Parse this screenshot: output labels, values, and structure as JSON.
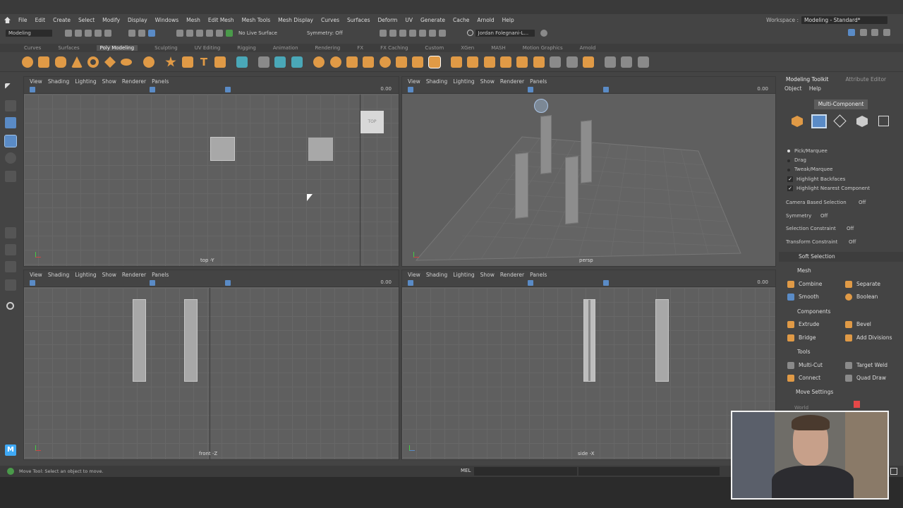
{
  "menubar": [
    "File",
    "Edit",
    "Create",
    "Select",
    "Modify",
    "Display",
    "Windows",
    "Mesh",
    "Edit Mesh",
    "Mesh Tools",
    "Mesh Display",
    "Curves",
    "Surfaces",
    "Deform",
    "UV",
    "Generate",
    "Cache",
    "Arnold",
    "Help"
  ],
  "workspace": {
    "label": "Workspace :",
    "value": "Modeling - Standard*"
  },
  "status": {
    "mode": "Modeling",
    "live_surface": "No Live Surface",
    "symmetry": "Symmetry: Off",
    "user": "Jordan Folegnani-L..."
  },
  "shelf_tabs": [
    "Curves",
    "Surfaces",
    "Poly Modeling",
    "Sculpting",
    "UV Editing",
    "Rigging",
    "Animation",
    "Rendering",
    "FX",
    "FX Caching",
    "Custom",
    "XGen",
    "MASH",
    "Motion Graphics",
    "Arnold"
  ],
  "shelf_active": "Poly Modeling",
  "viewport_menu": [
    "View",
    "Shading",
    "Lighting",
    "Show",
    "Renderer",
    "Panels"
  ],
  "viewports": [
    {
      "label": "top -Y",
      "zoom": "0.00",
      "cube": "TOP"
    },
    {
      "label": "persp",
      "zoom": "0.00"
    },
    {
      "label": "front -Z",
      "zoom": "0.00"
    },
    {
      "label": "side -X",
      "zoom": "0.00"
    }
  ],
  "panel": {
    "tabs": [
      "Modeling Toolkit",
      "Attribute Editor"
    ],
    "submenu": [
      "Object",
      "Help"
    ],
    "mode_button": "Multi-Component",
    "selection_modes": [
      "Pick/Marquee",
      "Drag",
      "Tweak/Marquee"
    ],
    "checks": [
      "Highlight Backfaces",
      "Highlight Nearest Component"
    ],
    "camera_based": {
      "label": "Camera Based Selection",
      "value": "Off"
    },
    "symmetry": {
      "label": "Symmetry",
      "value": "Off"
    },
    "selection_constraint": {
      "label": "Selection Constraint",
      "value": "Off"
    },
    "transform_constraint": {
      "label": "Transform Constraint",
      "value": "Off"
    },
    "soft_selection": "Soft Selection",
    "mesh_section": "Mesh",
    "mesh_buttons": [
      "Combine",
      "Separate",
      "Smooth",
      "Boolean"
    ],
    "components_section": "Components",
    "component_buttons": [
      "Extrude",
      "Bevel",
      "Bridge",
      "Add Divisions"
    ],
    "tools_section": "Tools",
    "tool_buttons": [
      "Multi-Cut",
      "Target Weld",
      "Connect",
      "Quad Draw"
    ],
    "move_settings": "Move Settings",
    "world": "World"
  },
  "help_line": "Move Tool: Select an object to move.",
  "cmd_type": "MEL",
  "colors": {
    "accent": "#e09a46",
    "selected": "#5a8bc6",
    "bg": "#444444",
    "viewport": "#5f5f5f"
  }
}
